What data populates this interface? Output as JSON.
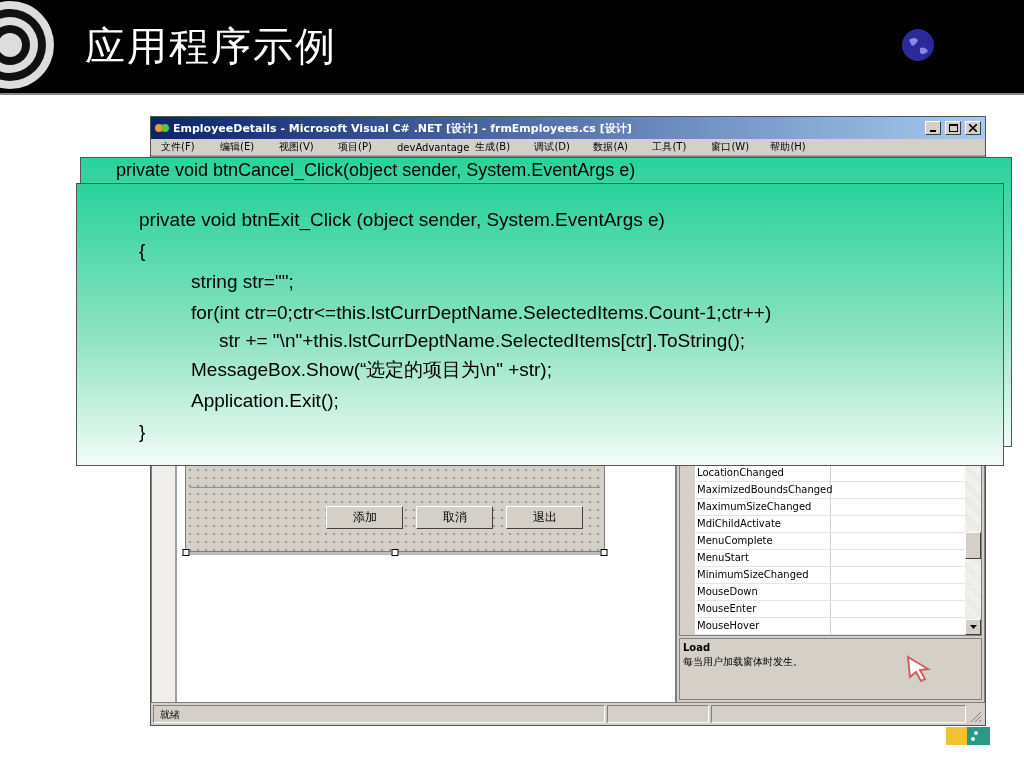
{
  "slide": {
    "title": "应用程序示例"
  },
  "window": {
    "title": "EmployeeDetails - Microsoft Visual C# .NET [设计] - frmEmployees.cs [设计]",
    "menu": [
      "文件(F)",
      "编辑(E)",
      "视图(V)",
      "项目(P)",
      "devAdvantage",
      "生成(B)",
      "调试(D)",
      "数据(A)",
      "工具(T)",
      "窗口(W)",
      "帮助(H)"
    ],
    "form_buttons": [
      "添加",
      "取消",
      "退出"
    ],
    "properties": [
      "LocationChanged",
      "MaximizedBoundsChanged",
      "MaximumSizeChanged",
      "MdiChildActivate",
      "MenuComplete",
      "MenuStart",
      "MinimumSizeChanged",
      "MouseDown",
      "MouseEnter",
      "MouseHover"
    ],
    "description": {
      "title": "Load",
      "text": "每当用户加载窗体时发生。"
    },
    "status_bar": [
      "就绪"
    ]
  },
  "code_panels": [
    {
      "header": "private void btnCancel_Click(object sender, System.EventArgs e)"
    },
    {
      "header": "private void btnExit_Click (object sender, System.EventArgs e)",
      "open": "{",
      "close": "}",
      "body": [
        {
          "text": "string str=\"\";"
        },
        {
          "text": "for(int ctr=0;ctr<=this.lstCurrDeptName.SelectedItems.Count-1;ctr++)",
          "children": [
            {
              "text": "str += \"\\n\"+this.lstCurrDeptName.SelectedItems[ctr].ToString();"
            }
          ]
        },
        {
          "text": "MessageBox.Show(“选定的项目为\\n\" +str);"
        },
        {
          "text": "Application.Exit();"
        }
      ]
    }
  ]
}
